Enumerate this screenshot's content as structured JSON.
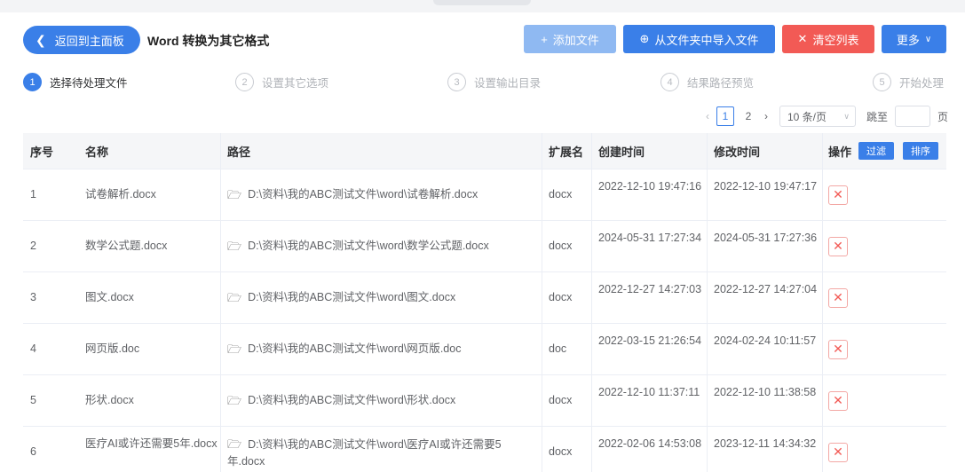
{
  "header": {
    "back_label": "返回到主面板",
    "title": "Word 转换为其它格式"
  },
  "toolbar": {
    "add_label": "添加文件",
    "import_label": "从文件夹中导入文件",
    "clear_label": "清空列表",
    "more_label": "更多"
  },
  "steps": [
    {
      "num": "1",
      "label": "选择待处理文件"
    },
    {
      "num": "2",
      "label": "设置其它选项"
    },
    {
      "num": "3",
      "label": "设置输出目录"
    },
    {
      "num": "4",
      "label": "结果路径预览"
    },
    {
      "num": "5",
      "label": "开始处理"
    }
  ],
  "pagination": {
    "pages": [
      "1",
      "2"
    ],
    "current": "1",
    "page_size": "10 条/页",
    "goto_label": "跳至",
    "page_label": "页"
  },
  "table": {
    "headers": {
      "index": "序号",
      "name": "名称",
      "path": "路径",
      "ext": "扩展名",
      "created": "创建时间",
      "modified": "修改时间",
      "action": "操作",
      "filter": "过滤",
      "sort": "排序"
    },
    "rows": [
      {
        "index": "1",
        "name": "试卷解析.docx",
        "path": "D:\\资料\\我的ABC测试文件\\word\\试卷解析.docx",
        "ext": "docx",
        "created": "2022-12-10 19:47:16",
        "modified": "2022-12-10 19:47:17"
      },
      {
        "index": "2",
        "name": "数学公式题.docx",
        "path": "D:\\资料\\我的ABC测试文件\\word\\数学公式题.docx",
        "ext": "docx",
        "created": "2024-05-31 17:27:34",
        "modified": "2024-05-31 17:27:36"
      },
      {
        "index": "3",
        "name": "图文.docx",
        "path": "D:\\资料\\我的ABC测试文件\\word\\图文.docx",
        "ext": "docx",
        "created": "2022-12-27 14:27:03",
        "modified": "2022-12-27 14:27:04"
      },
      {
        "index": "4",
        "name": "网页版.doc",
        "path": "D:\\资料\\我的ABC测试文件\\word\\网页版.doc",
        "ext": "doc",
        "created": "2022-03-15 21:26:54",
        "modified": "2024-02-24 10:11:57"
      },
      {
        "index": "5",
        "name": "形状.docx",
        "path": "D:\\资料\\我的ABC测试文件\\word\\形状.docx",
        "ext": "docx",
        "created": "2022-12-10 11:37:11",
        "modified": "2022-12-10 11:38:58"
      },
      {
        "index": "6",
        "name": "医疗AI或许还需要5年.docx",
        "path": "D:\\资料\\我的ABC测试文件\\word\\医疗AI或许还需要5年.docx",
        "ext": "docx",
        "created": "2022-02-06 14:53:08",
        "modified": "2023-12-11 14:34:32"
      }
    ]
  },
  "icons": {
    "back": "chevron-left-icon",
    "add": "plus-icon",
    "import": "folder-import-icon",
    "clear": "close-icon",
    "more": "chevron-down-icon",
    "folder": "folder-icon",
    "delete": "close-icon"
  },
  "colors": {
    "primary": "#3a7fe8",
    "primary_disabled": "#8fb9f2",
    "danger": "#f25a55"
  }
}
